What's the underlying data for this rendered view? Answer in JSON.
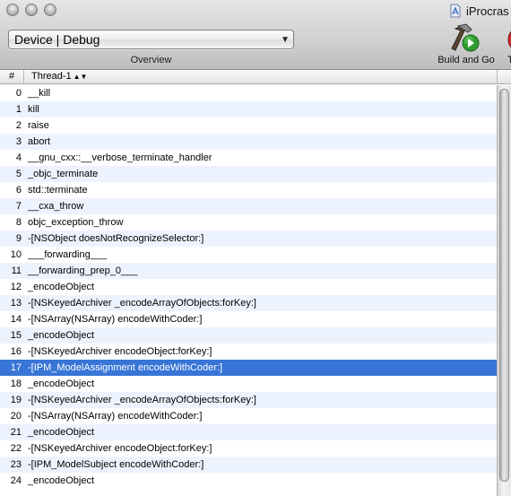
{
  "window": {
    "title": "iProcras",
    "controls": [
      "close",
      "minimize",
      "zoom"
    ]
  },
  "toolbar": {
    "scheme_popup": {
      "value": "Device | Debug"
    },
    "overview_label": "Overview",
    "build_and_go": {
      "label": "Build and Go",
      "icon": "hammer-play-icon"
    },
    "next_tool_partial_label": "T"
  },
  "table": {
    "columns": [
      {
        "label": "#"
      },
      {
        "label": "Thread-1"
      }
    ],
    "selected_index": 17,
    "rows": [
      {
        "num": "0",
        "fn": "__kill"
      },
      {
        "num": "1",
        "fn": "kill"
      },
      {
        "num": "2",
        "fn": "raise"
      },
      {
        "num": "3",
        "fn": "abort"
      },
      {
        "num": "4",
        "fn": "__gnu_cxx::__verbose_terminate_handler"
      },
      {
        "num": "5",
        "fn": "_objc_terminate"
      },
      {
        "num": "6",
        "fn": "std::terminate"
      },
      {
        "num": "7",
        "fn": "__cxa_throw"
      },
      {
        "num": "8",
        "fn": "objc_exception_throw"
      },
      {
        "num": "9",
        "fn": "-[NSObject doesNotRecognizeSelector:]"
      },
      {
        "num": "10",
        "fn": "___forwarding___"
      },
      {
        "num": "11",
        "fn": "__forwarding_prep_0___"
      },
      {
        "num": "12",
        "fn": "_encodeObject"
      },
      {
        "num": "13",
        "fn": "-[NSKeyedArchiver _encodeArrayOfObjects:forKey:]"
      },
      {
        "num": "14",
        "fn": "-[NSArray(NSArray) encodeWithCoder:]"
      },
      {
        "num": "15",
        "fn": "_encodeObject"
      },
      {
        "num": "16",
        "fn": "-[NSKeyedArchiver encodeObject:forKey:]"
      },
      {
        "num": "17",
        "fn": "-[IPM_ModelAssignment encodeWithCoder:]"
      },
      {
        "num": "18",
        "fn": "_encodeObject"
      },
      {
        "num": "19",
        "fn": "-[NSKeyedArchiver _encodeArrayOfObjects:forKey:]"
      },
      {
        "num": "20",
        "fn": "-[NSArray(NSArray) encodeWithCoder:]"
      },
      {
        "num": "21",
        "fn": "_encodeObject"
      },
      {
        "num": "22",
        "fn": "-[NSKeyedArchiver encodeObject:forKey:]"
      },
      {
        "num": "23",
        "fn": "-[IPM_ModelSubject encodeWithCoder:]"
      },
      {
        "num": "24",
        "fn": "_encodeObject"
      }
    ]
  },
  "colors": {
    "selection": "#3875d7",
    "alternate_row": "#edf3fe"
  }
}
